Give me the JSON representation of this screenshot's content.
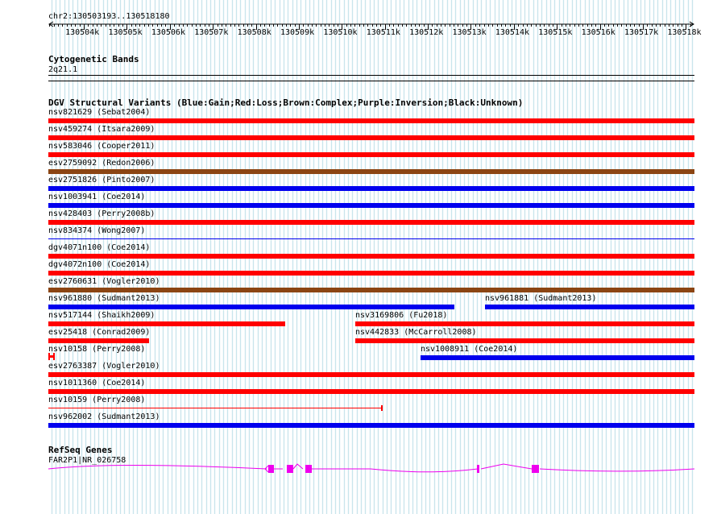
{
  "ruler": {
    "range_label": "chr2:130503193..130518180",
    "ticks": [
      "130504k",
      "130505k",
      "130506k",
      "130507k",
      "130508k",
      "130509k",
      "130510k",
      "130511k",
      "130512k",
      "130513k",
      "130514k",
      "130515k",
      "130516k",
      "130517k",
      "130518k"
    ]
  },
  "cyto": {
    "title": "Cytogenetic Bands",
    "band": "2q21.1"
  },
  "dgv": {
    "title": "DGV Structural Variants (Blue:Gain;Red:Loss;Brown:Complex;Purple:Inversion;Black:Unknown)",
    "colors": {
      "gain": "#0000ee",
      "loss": "#ff0000",
      "complex": "#8b4513"
    },
    "features": [
      {
        "label": "nsv821629 (Sebat2004)",
        "type": "loss"
      },
      {
        "label": "nsv459274 (Itsara2009)",
        "type": "loss"
      },
      {
        "label": "nsv583046 (Cooper2011)",
        "type": "loss"
      },
      {
        "label": "esv2759092 (Redon2006)",
        "type": "complex"
      },
      {
        "label": "esv2751826 (Pinto2007)",
        "type": "gain"
      },
      {
        "label": "nsv1003941 (Coe2014)",
        "type": "gain"
      },
      {
        "label": "nsv428403 (Perry2008b)",
        "type": "loss"
      },
      {
        "label": "nsv834374 (Wong2007)",
        "type": "gain"
      },
      {
        "label": "dgv4071n100 (Coe2014)",
        "type": "loss"
      },
      {
        "label": "dgv4072n100 (Coe2014)",
        "type": "loss"
      },
      {
        "label": "esv2760631 (Vogler2010)",
        "type": "complex"
      },
      {
        "label": "nsv961880 (Sudmant2013)",
        "type": "gain"
      },
      {
        "label": "nsv961881 (Sudmant2013)",
        "type": "gain"
      },
      {
        "label": "nsv517144 (Shaikh2009)",
        "type": "loss"
      },
      {
        "label": "nsv3169806 (Fu2018)",
        "type": "loss"
      },
      {
        "label": "esv25418 (Conrad2009)",
        "type": "loss"
      },
      {
        "label": "nsv442833 (McCarroll2008)",
        "type": "loss"
      },
      {
        "label": "nsv10158 (Perry2008)",
        "type": "loss"
      },
      {
        "label": "nsv1008911 (Coe2014)",
        "type": "gain"
      },
      {
        "label": "esv2763387 (Vogler2010)",
        "type": "loss"
      },
      {
        "label": "nsv1011360 (Coe2014)",
        "type": "loss"
      },
      {
        "label": "nsv10159 (Perry2008)",
        "type": "loss"
      },
      {
        "label": "nsv962002 (Sudmant2013)",
        "type": "gain"
      }
    ]
  },
  "refseq": {
    "title": "RefSeq Genes",
    "gene_label": "FAR2P1|NR_026758",
    "color": "#ee00ee"
  }
}
